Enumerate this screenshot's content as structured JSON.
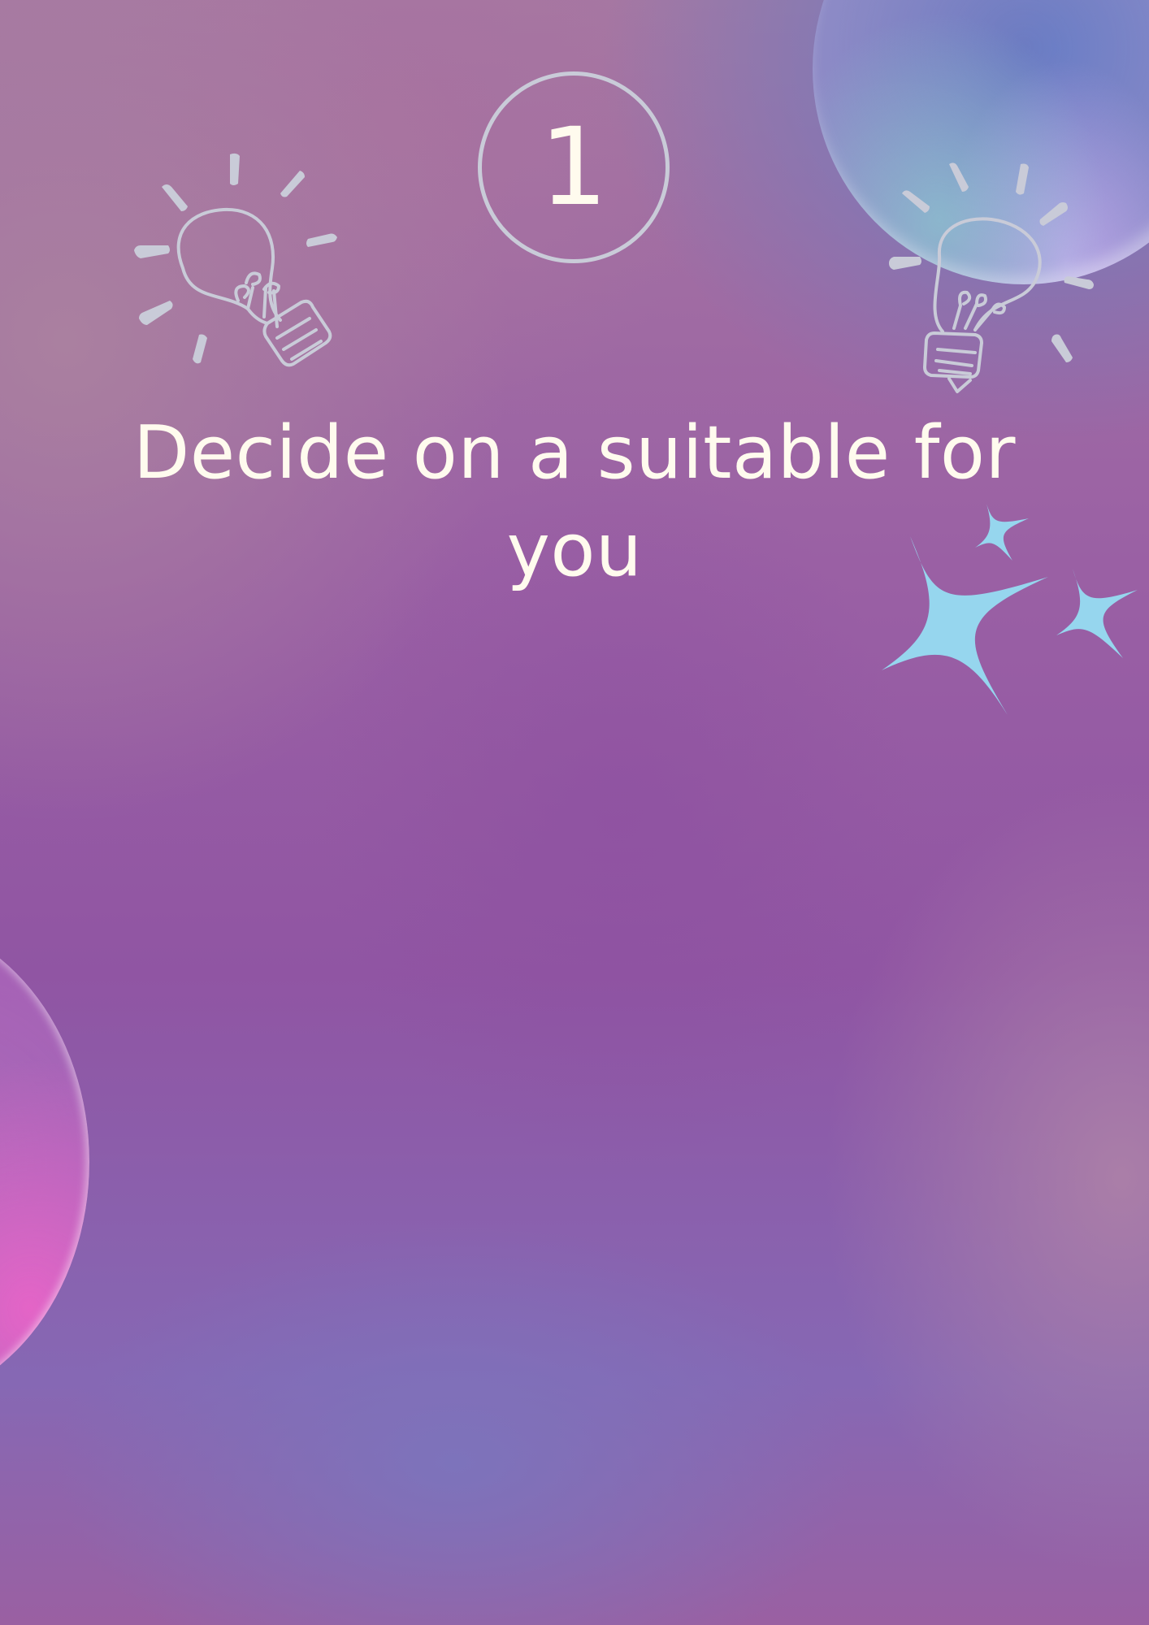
{
  "step": {
    "number": "1"
  },
  "heading": {
    "text": "Decide on a suitable for you"
  },
  "decorations": {
    "icons": [
      "lightbulb-icon",
      "lightbulb-icon",
      "sparkles-icon"
    ],
    "colors": {
      "background_purple": "#9055a3",
      "outline_gray": "#c9cbd8",
      "text_cream": "#fffbee",
      "sparkle_blue": "#96d6ee"
    }
  }
}
